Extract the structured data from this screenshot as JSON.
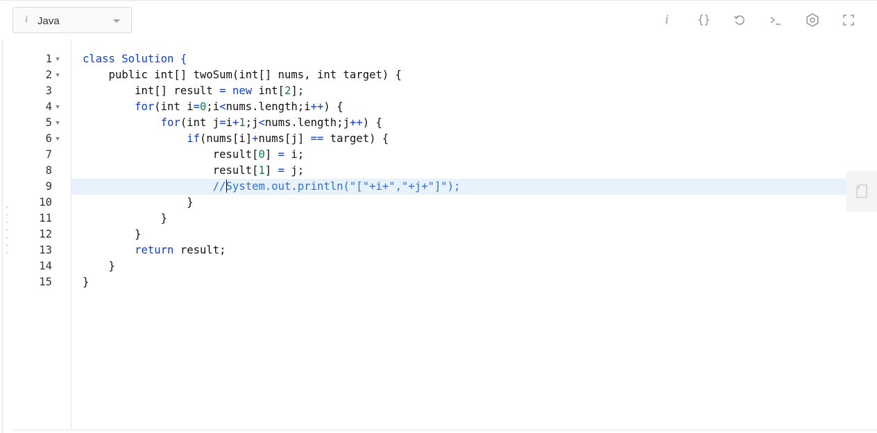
{
  "toolbar": {
    "language_info_glyph": "i",
    "language": "Java",
    "icons": [
      {
        "name": "info-icon",
        "glyph": "i"
      },
      {
        "name": "format-code-icon",
        "glyph": "{}"
      },
      {
        "name": "reset-icon",
        "glyph": "undo"
      },
      {
        "name": "console-icon",
        "glyph": "terminal"
      },
      {
        "name": "settings-icon",
        "glyph": "gear"
      },
      {
        "name": "fullscreen-icon",
        "glyph": "expand"
      }
    ]
  },
  "editor": {
    "active_line": 9,
    "lines": [
      {
        "n": "1",
        "fold": true
      },
      {
        "n": "2",
        "fold": true
      },
      {
        "n": "3",
        "fold": false
      },
      {
        "n": "4",
        "fold": true
      },
      {
        "n": "5",
        "fold": true
      },
      {
        "n": "6",
        "fold": true
      },
      {
        "n": "7",
        "fold": false
      },
      {
        "n": "8",
        "fold": false
      },
      {
        "n": "9",
        "fold": false
      },
      {
        "n": "10",
        "fold": false
      },
      {
        "n": "11",
        "fold": false
      },
      {
        "n": "12",
        "fold": false
      },
      {
        "n": "13",
        "fold": false
      },
      {
        "n": "14",
        "fold": false
      },
      {
        "n": "15",
        "fold": false
      }
    ],
    "code": {
      "l1": {
        "a": "class Solution {"
      },
      "l2": {
        "a": "    public int[] twoSum(int[] nums, int target) {"
      },
      "l3": {
        "a": "        int[] result ",
        "b": "=",
        "c": " ",
        "d": "new",
        "e": " int[",
        "f": "2",
        "g": "];"
      },
      "l4": {
        "a": "        ",
        "b": "for",
        "c": "(int i",
        "d": "=",
        "e": "0",
        "f": ";i",
        "g": "<",
        "h": "nums.length;i",
        "i": "++",
        "j": ") {"
      },
      "l5": {
        "a": "            ",
        "b": "for",
        "c": "(int j",
        "d": "=",
        "e": "i",
        "f": "+",
        "g": "1",
        "h": ";j",
        "i": "<",
        "j": "nums.length;j",
        "k": "++",
        "l": ") {"
      },
      "l6": {
        "a": "                ",
        "b": "if",
        "c": "(nums[i]",
        "d": "+",
        "e": "nums[j] ",
        "f": "==",
        "g": " target) {"
      },
      "l7": {
        "a": "                    result[",
        "b": "0",
        "c": "] ",
        "d": "=",
        "e": " i;"
      },
      "l8": {
        "a": "                    result[",
        "b": "1",
        "c": "] ",
        "d": "=",
        "e": " j;"
      },
      "l9": {
        "a": "                    ",
        "b": "//",
        "c": "System.out.println(\"[\"+i+\",\"+j+\"]\");"
      },
      "l10": {
        "a": "                }"
      },
      "l11": {
        "a": "            }"
      },
      "l12": {
        "a": "        }"
      },
      "l13": {
        "a": "        ",
        "b": "return",
        "c": " result;"
      },
      "l14": {
        "a": "    }"
      },
      "l15": {
        "a": "}"
      }
    }
  },
  "colors": {
    "keyword": "#0a3fd6",
    "number": "#0a7a5a",
    "comment": "#2e6fd8",
    "active_line_bg": "#e8f2fc"
  }
}
